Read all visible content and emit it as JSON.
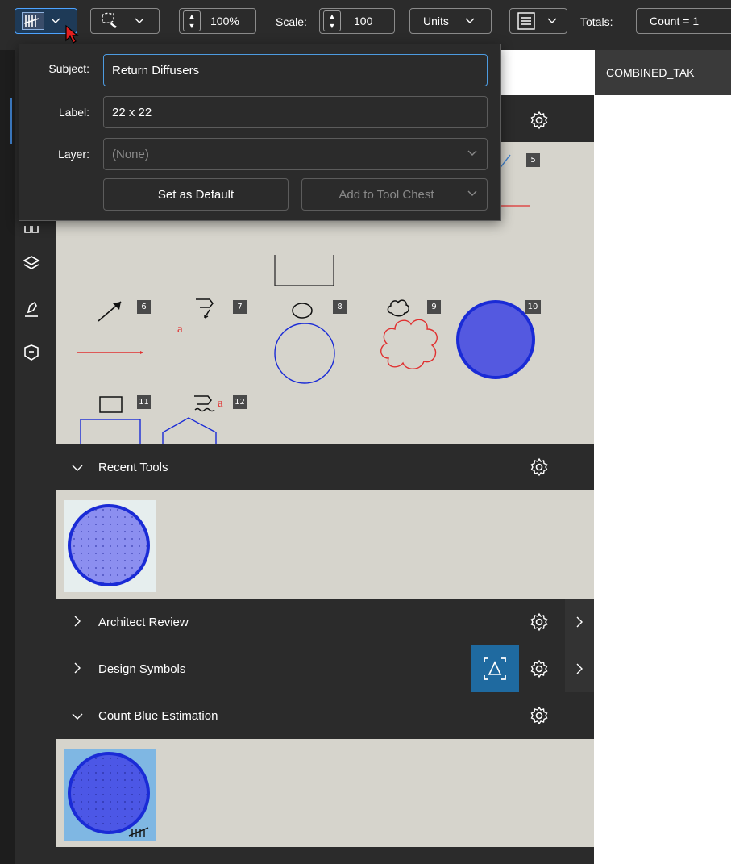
{
  "toolbar": {
    "zoom_value": "100%",
    "scale_label": "Scale:",
    "scale_value": "100",
    "units_label": "Units",
    "totals_label": "Totals:",
    "totals_value": "Count = 1"
  },
  "document_tab": {
    "title": "COMBINED_TAK"
  },
  "popup": {
    "subject_label": "Subject:",
    "subject_value": "Return Diffusers",
    "label_label": "Label:",
    "label_value": "22 x 22",
    "layer_label": "Layer:",
    "layer_value": "(None)",
    "set_default_label": "Set as Default",
    "add_tool_chest_label": "Add to Tool Chest"
  },
  "tool_numbers": [
    "5",
    "6",
    "7",
    "8",
    "9",
    "10",
    "11",
    "12"
  ],
  "markup_letters": {
    "text_a": "a"
  },
  "sections": {
    "recent_tools": "Recent Tools",
    "architect_review": "Architect Review",
    "design_symbols": "Design Symbols",
    "count_blue": "Count Blue Estimation"
  },
  "colors": {
    "accent_blue": "#4d9be0",
    "panel_grey": "#d6d4cc",
    "dark_bg": "#2b2b2b",
    "markup_red": "#e03030",
    "markup_blue": "#1a2bd6",
    "fill_blue": "#5459e0",
    "capture_blue": "#1f6aa0"
  },
  "icons": [
    "count-tool-icon",
    "lasso-icon",
    "gear-icon",
    "layers-icon",
    "pen-icon",
    "stamp-icon",
    "chevron-down-icon",
    "chevron-right-icon",
    "capture-icon"
  ]
}
